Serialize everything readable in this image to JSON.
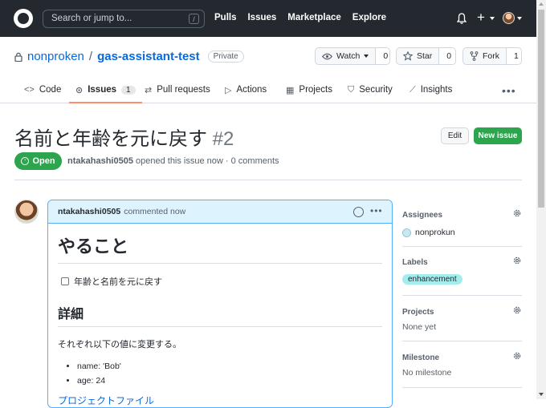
{
  "header": {
    "search_placeholder": "Search or jump to...",
    "search_shortcut": "/",
    "nav": [
      "Pulls",
      "Issues",
      "Marketplace",
      "Explore"
    ],
    "plus": "+"
  },
  "repo": {
    "owner": "nonproken",
    "separator": "/",
    "name": "gas-assistant-test",
    "visibility": "Private",
    "watch_label": "Watch",
    "watch_count": "0",
    "star_label": "Star",
    "star_count": "0",
    "fork_label": "Fork",
    "fork_count": "1"
  },
  "tabs": [
    {
      "label": "Code",
      "icon": "<>"
    },
    {
      "label": "Issues",
      "icon": "⊙",
      "count": "1"
    },
    {
      "label": "Pull requests",
      "icon": "⇄"
    },
    {
      "label": "Actions",
      "icon": "▷"
    },
    {
      "label": "Projects",
      "icon": "▦"
    },
    {
      "label": "Security",
      "icon": "⛉"
    },
    {
      "label": "Insights",
      "icon": "⟋"
    }
  ],
  "more": "•••",
  "issue": {
    "title": "名前と年齢を元に戻す",
    "number": "#2",
    "edit_label": "Edit",
    "new_label": "New issue",
    "status": "Open",
    "author": "ntakahashi0505",
    "meta_text": "opened this issue now · 0 comments"
  },
  "comment": {
    "author": "ntakahashi0505",
    "time": "commented now",
    "heading1": "やること",
    "task": "年齢と名前を元に戻す",
    "heading2": "詳細",
    "paragraph": "それぞれ以下の値に変更する。",
    "list": [
      "name: 'Bob'",
      "age: 24"
    ],
    "link": "プロジェクトファイル"
  },
  "sidebar": {
    "assignees_label": "Assignees",
    "assignee": "nonprokun",
    "labels_label": "Labels",
    "label": "enhancement",
    "projects_label": "Projects",
    "projects_value": "None yet",
    "milestone_label": "Milestone",
    "milestone_value": "No milestone"
  },
  "colors": {
    "header_bg": "#24292f",
    "accent_green": "#2da44e",
    "link_blue": "#0969da",
    "tab_underline": "#fd8c73",
    "label_bg": "#a2eeef"
  }
}
